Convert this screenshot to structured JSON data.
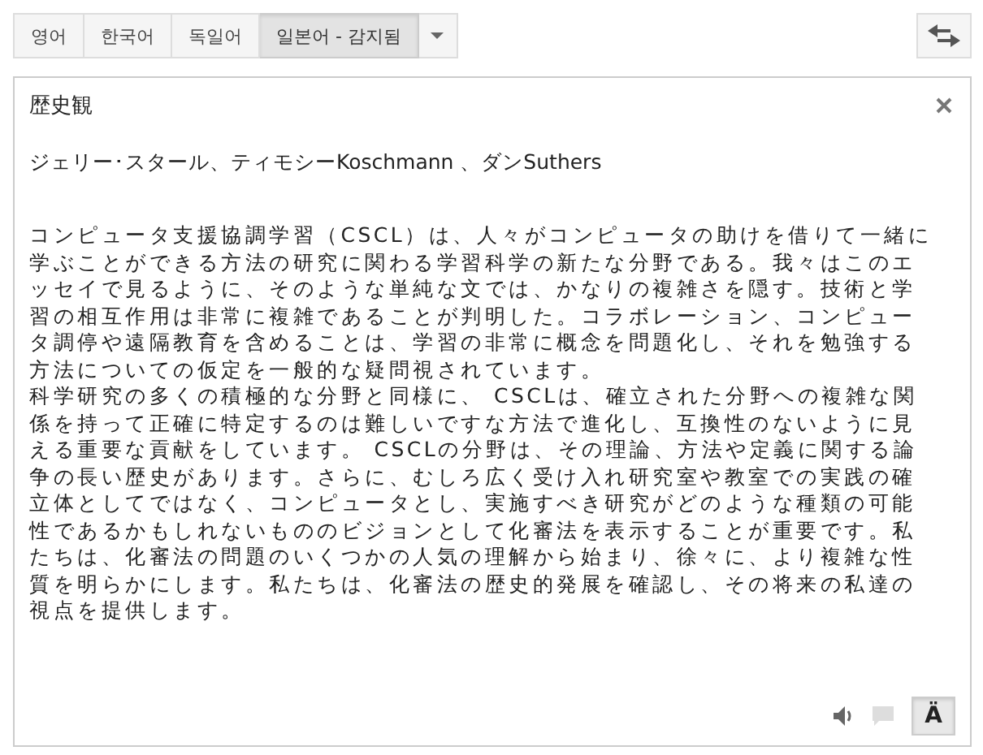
{
  "language_tabs": [
    {
      "label": "영어",
      "selected": false
    },
    {
      "label": "한국어",
      "selected": false
    },
    {
      "label": "독일어",
      "selected": false
    },
    {
      "label": "일본어 - 감지됨",
      "selected": true
    }
  ],
  "source": {
    "title": "歴史観",
    "authors": "ジェリー･スタール、ティモシーKoschmann 、ダンSuthers",
    "paragraphs": [
      "コンピュータ支援協調学習（CSCL）は、人々がコンピュータの助けを借りて一緒に学ぶことができる方法の研究に関わる学習科学の新たな分野である。我々はこのエッセイで見るように、そのような単純な文では、かなりの複雑さを隠す。技術と学習の相互作用は非常に複雑であることが判明した。コラボレーション、コンピュータ調停や遠隔教育を含めることは、学習の非常に概念を問題化し、それを勉強する方法についての仮定を一般的な疑問視されています。",
      "科学研究の多くの積極的な分野と同様に、 CSCLは、確立された分野への複雑な関係を持って正確に特定するのは難しいですな方法で進化し、互換性のないように見える重要な貢献をしています。 CSCLの分野は、その理論、方法や定義に関する論争の長い歴史があります。さらに、むしろ広く受け入れ研究室や教室での実践の確立体としてではなく、コンピュータとし、実施すべき研究がどのような種類の可能性であるかもしれないもののビジョンとして化審法を表示することが重要です。私たちは、化審法の問題のいくつかの人気の理解から始まり、徐々に、より複雑な性質を明らかにします。私たちは、化審法の歴史的発展を確認し、その将来の私達の視点を提供します。"
    ],
    "font_button": {
      "label": "Ä",
      "selected": true
    }
  }
}
